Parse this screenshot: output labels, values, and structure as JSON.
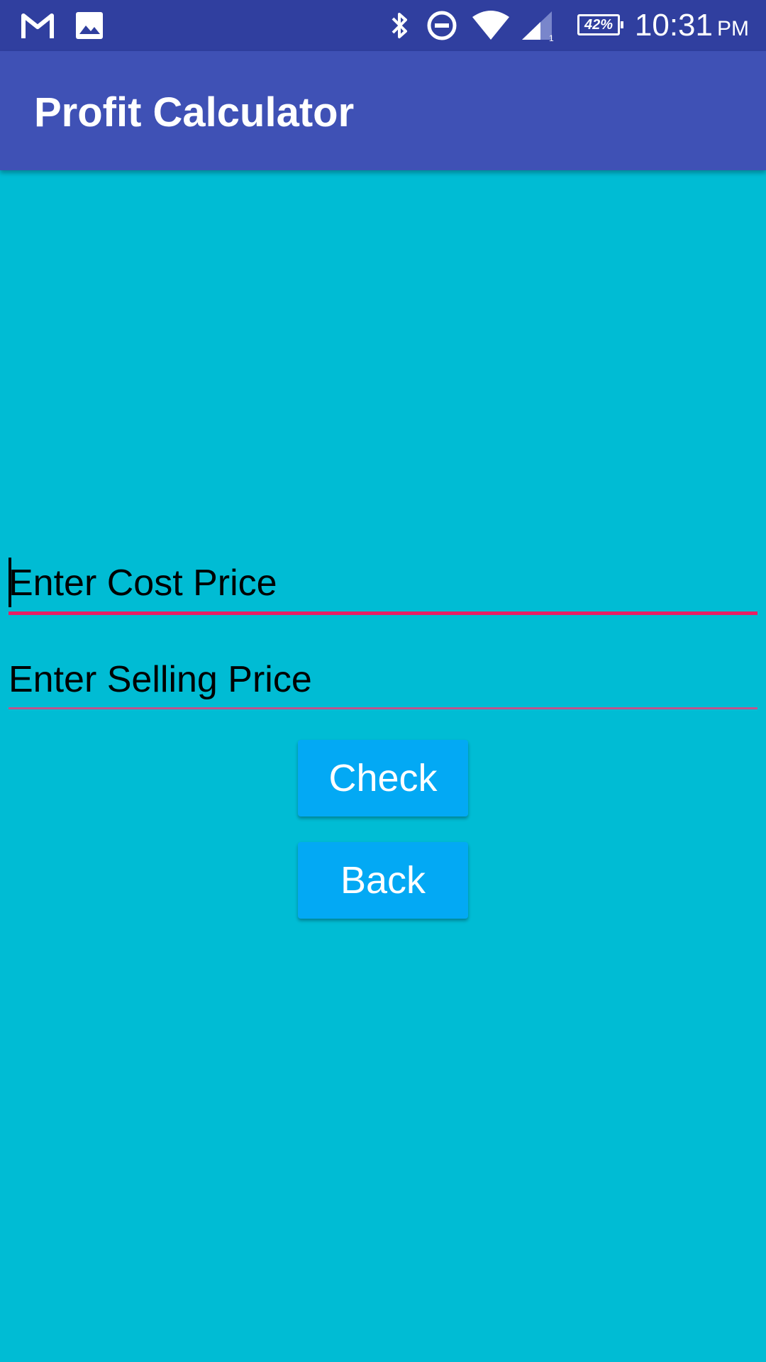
{
  "status_bar": {
    "icons": [
      "gmail-icon",
      "image-icon",
      "bluetooth-icon",
      "do-not-disturb-icon",
      "wifi-icon",
      "signal-icon",
      "battery-icon"
    ],
    "signal_sim": "1",
    "battery_percent": "42%",
    "time": "10:31",
    "ampm": "PM"
  },
  "app_bar": {
    "title": "Profit Calculator",
    "color": "#3f51b5"
  },
  "form": {
    "cost_price": {
      "placeholder": "Enter Cost Price",
      "value": ""
    },
    "selling_price": {
      "placeholder": "Enter Selling Price",
      "value": ""
    }
  },
  "buttons": {
    "check_label": "Check",
    "back_label": "Back"
  },
  "colors": {
    "background": "#00bcd4",
    "status_bar": "#303f9f",
    "accent": "#e91e63",
    "button": "#03a9f4"
  }
}
